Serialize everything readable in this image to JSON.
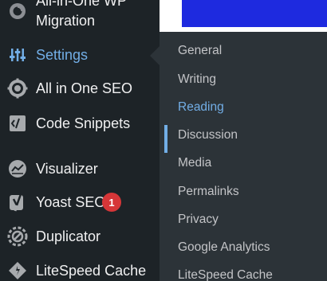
{
  "sidebar": {
    "items": [
      {
        "label": "All-in-One WP",
        "label2": "Migration",
        "icon": "all-in-one-wp-migration-icon"
      },
      {
        "label": "Settings",
        "icon": "settings-sliders-icon",
        "current": true
      },
      {
        "label": "All in One SEO",
        "icon": "aioseo-gear-icon"
      },
      {
        "label": "Code Snippets",
        "icon": "code-snippets-icon"
      },
      {
        "label": "Visualizer",
        "icon": "visualizer-chart-icon"
      },
      {
        "label": "Yoast SEO",
        "icon": "yoast-icon",
        "badge": "1"
      },
      {
        "label": "Duplicator",
        "icon": "duplicator-icon"
      },
      {
        "label": "LiteSpeed Cache",
        "icon": "litespeed-diamond-icon"
      }
    ]
  },
  "submenu": {
    "items": [
      {
        "label": "General"
      },
      {
        "label": "Writing"
      },
      {
        "label": "Reading",
        "current": true
      },
      {
        "label": "Discussion"
      },
      {
        "label": "Media"
      },
      {
        "label": "Permalinks"
      },
      {
        "label": "Privacy"
      },
      {
        "label": "Google Analytics"
      },
      {
        "label": "LiteSpeed Cache"
      }
    ]
  },
  "colors": {
    "menu_bg": "#1d2327",
    "submenu_bg": "#2c3338",
    "accent": "#72aee6",
    "badge": "#d63638",
    "banner": "#1e2adf"
  }
}
